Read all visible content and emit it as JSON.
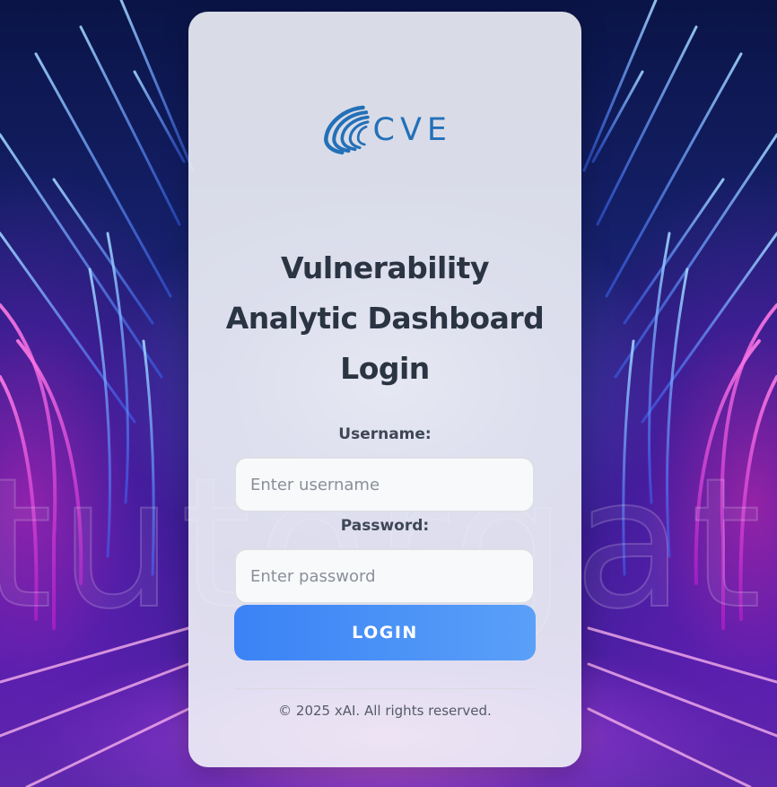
{
  "logo": {
    "text": "CVE",
    "icon": "cve-swoosh-logo-icon",
    "color": "#2470b8"
  },
  "background": {
    "watermark_text": "tutorgate"
  },
  "title": {
    "line1": "Vulnerability",
    "line2": "Analytic Dashboard",
    "line3": "Login"
  },
  "form": {
    "username_label": "Username:",
    "username_placeholder": "Enter username",
    "username_value": "",
    "password_label": "Password:",
    "password_placeholder": "Enter password",
    "password_value": "",
    "login_label": "LOGIN"
  },
  "footer": {
    "text": "© 2025 xAI. All rights reserved."
  },
  "colors": {
    "accent": "#3b82f6",
    "accent_light": "#5aa0f8",
    "title_text": "#2b3442",
    "card_bg": "#f0f2f7"
  }
}
